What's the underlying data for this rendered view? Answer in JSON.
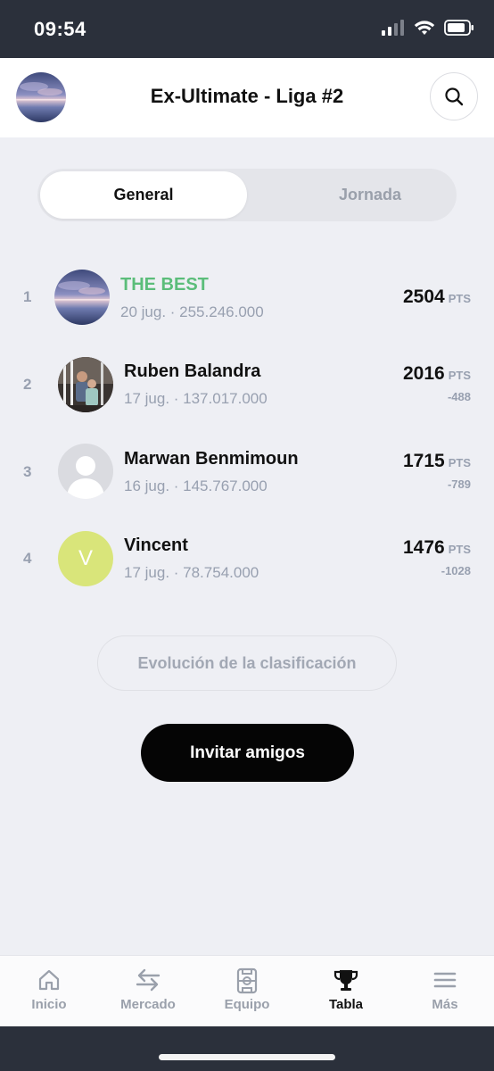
{
  "status_bar": {
    "time": "09:54",
    "icons": [
      "cellular-signal-icon",
      "wifi-icon",
      "battery-icon"
    ]
  },
  "header": {
    "title": "Ex-Ultimate - Liga #2",
    "avatar_icon": "league-avatar",
    "search_icon": "search-icon"
  },
  "segmented": {
    "tabs": [
      {
        "label": "General",
        "active": true
      },
      {
        "label": "Jornada",
        "active": false
      }
    ]
  },
  "standings": [
    {
      "rank": "1",
      "name": "THE BEST",
      "details": "20 jug. · 255.246.000",
      "points": "2504",
      "unit": "PTS",
      "diff": "",
      "highlight": true
    },
    {
      "rank": "2",
      "name": "Ruben Balandra",
      "details": "17 jug. · 137.017.000",
      "points": "2016",
      "unit": "PTS",
      "diff": "-488",
      "highlight": false
    },
    {
      "rank": "3",
      "name": "Marwan Benmimoun",
      "details": "16 jug. · 145.767.000",
      "points": "1715",
      "unit": "PTS",
      "diff": "-789",
      "highlight": false
    },
    {
      "rank": "4",
      "name": "Vincent",
      "details": "17 jug. · 78.754.000",
      "points": "1476",
      "unit": "PTS",
      "diff": "-1028",
      "highlight": false,
      "avatar_letter": "V"
    }
  ],
  "actions": {
    "evolution_label": "Evolución de la clasificación",
    "invite_label": "Invitar amigos"
  },
  "tabbar": {
    "items": [
      {
        "label": "Inicio",
        "icon": "home-icon"
      },
      {
        "label": "Mercado",
        "icon": "transfer-arrows-icon"
      },
      {
        "label": "Equipo",
        "icon": "team-field-icon"
      },
      {
        "label": "Tabla",
        "icon": "trophy-icon",
        "active": true
      },
      {
        "label": "Más",
        "icon": "menu-icon"
      }
    ]
  },
  "colors": {
    "accent_green": "#5bbd7a",
    "avatar_yellow": "#d9e57a",
    "status_bar": "#2b303b",
    "muted_text": "#98a0b0"
  }
}
